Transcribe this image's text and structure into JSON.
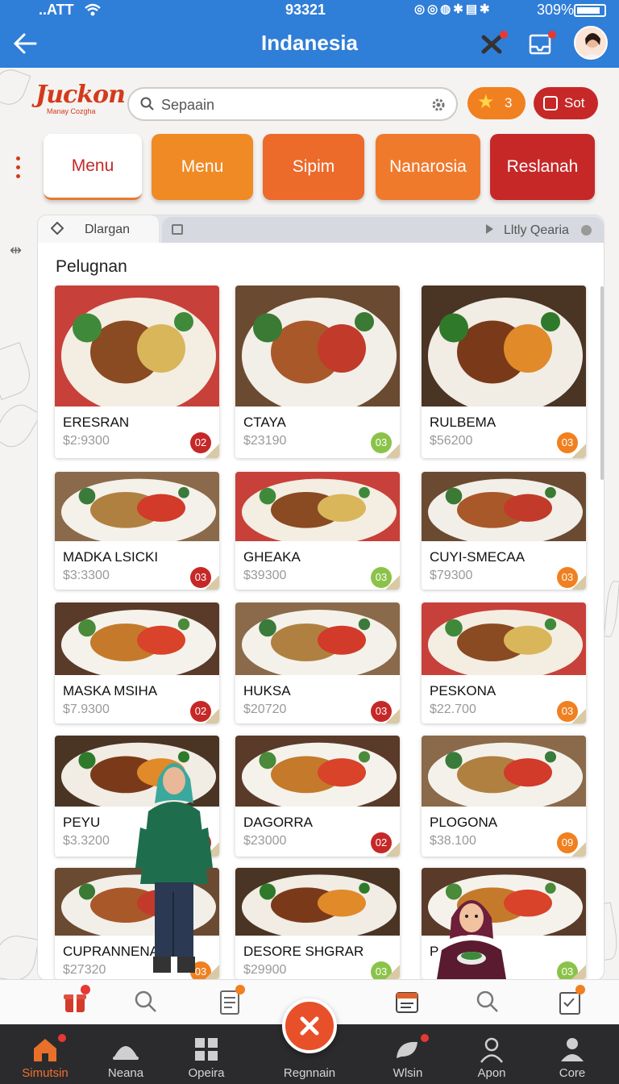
{
  "status_bar": {
    "carrier": "..ATT",
    "time": "93321",
    "battery": "309%"
  },
  "header": {
    "title": "Indanesia"
  },
  "logo": {
    "line1": "Juckon",
    "line2": "Manay Cozgha"
  },
  "search": {
    "placeholder": "Sepaain"
  },
  "favorites": {
    "count": "3"
  },
  "sort": {
    "label": "Sot"
  },
  "categories": [
    {
      "label": "Menu",
      "color": "#ffffff"
    },
    {
      "label": "Menu",
      "color": "#f08a24"
    },
    {
      "label": "Sipim",
      "color": "#ec6a2a"
    },
    {
      "label": "Nanarosia",
      "color": "#f07a2c"
    },
    {
      "label": "Reslanah",
      "color": "#c62828"
    }
  ],
  "tabs": {
    "left": "Dlargan",
    "right": "Lltly Qearia"
  },
  "section_title": "Pelugnan",
  "dishes": [
    {
      "name": "ERESRAN",
      "price": "$2:9300",
      "badge": "02",
      "badge_color": "#c62828"
    },
    {
      "name": "CTAYA",
      "price": "$23190",
      "badge": "03",
      "badge_color": "#8bc34a"
    },
    {
      "name": "RULBEMA",
      "price": "$56200",
      "badge": "03",
      "badge_color": "#f08020"
    },
    {
      "name": "MADKA LSICKI",
      "price": "$3:3300",
      "badge": "03",
      "badge_color": "#c62828"
    },
    {
      "name": "GHEAKA",
      "price": "$39300",
      "badge": "03",
      "badge_color": "#8bc34a"
    },
    {
      "name": "CUYI-SMECAA",
      "price": "$79300",
      "badge": "03",
      "badge_color": "#f08020"
    },
    {
      "name": "MASKA MSIHA",
      "price": "$7.9300",
      "badge": "02",
      "badge_color": "#c62828"
    },
    {
      "name": "HUKSA",
      "price": "$20720",
      "badge": "03",
      "badge_color": "#c62828"
    },
    {
      "name": "PESKONA",
      "price": "$22.700",
      "badge": "03",
      "badge_color": "#f08020"
    },
    {
      "name": "PEYU",
      "price": "$3.3200",
      "badge": "03",
      "badge_color": "#c62828"
    },
    {
      "name": "DAGORRA",
      "price": "$23000",
      "badge": "02",
      "badge_color": "#c62828"
    },
    {
      "name": "PLOGONA",
      "price": "$38.100",
      "badge": "09",
      "badge_color": "#f08020"
    },
    {
      "name": "CUPRANNENA",
      "price": "$27320",
      "badge": "03",
      "badge_color": "#f08020"
    },
    {
      "name": "DESORE SHGRAR",
      "price": "$29900",
      "badge": "03",
      "badge_color": "#8bc34a"
    },
    {
      "name": "P",
      "price": "",
      "badge": "03",
      "badge_color": "#8bc34a"
    }
  ],
  "quickbar": [
    {
      "icon": "gift-icon",
      "badge": true
    },
    {
      "icon": "search-icon",
      "badge": false
    },
    {
      "icon": "clipboard-icon",
      "badge": true
    },
    {
      "icon": "calendar-icon",
      "badge": false
    },
    {
      "icon": "search-icon",
      "badge": false
    },
    {
      "icon": "checklist-icon",
      "badge": true
    }
  ],
  "bottom_nav": [
    {
      "label": "Simutsin",
      "icon": "home-icon",
      "active": true
    },
    {
      "label": "Neana",
      "icon": "dish-icon",
      "active": false
    },
    {
      "label": "Opeira",
      "icon": "grid-icon",
      "active": false
    },
    {
      "label": "Regnnain",
      "icon": "close-icon",
      "active": false
    },
    {
      "label": "Wlsin",
      "icon": "chat-icon",
      "active": false
    },
    {
      "label": "Apon",
      "icon": "user-icon",
      "active": false
    },
    {
      "label": "Core",
      "icon": "profile-icon",
      "active": false
    }
  ],
  "colors": {
    "header": "#2f7ed8",
    "accent": "#f08020",
    "brand_red": "#c62828",
    "nav_bg": "#2b2b2d"
  }
}
